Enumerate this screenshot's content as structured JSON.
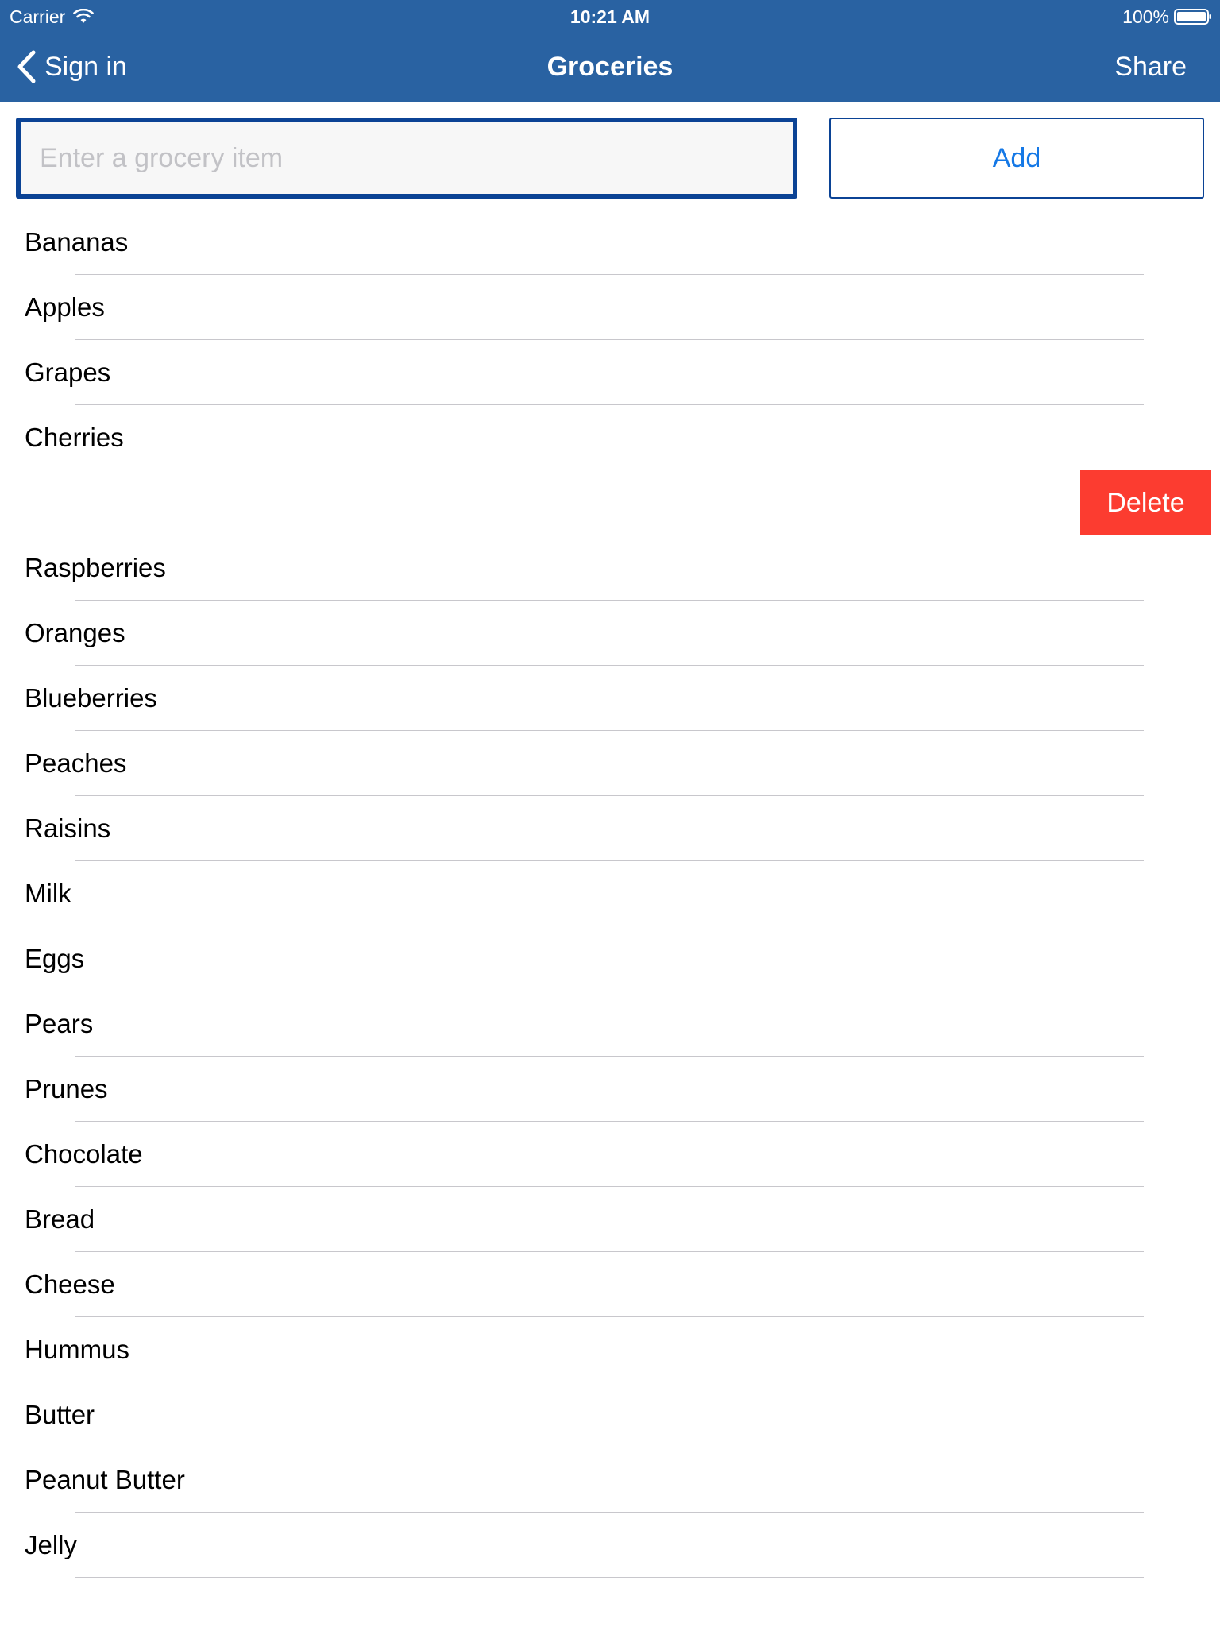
{
  "status_bar": {
    "carrier": "Carrier",
    "time": "10:21 AM",
    "battery": "100%"
  },
  "nav": {
    "back_label": "Sign in",
    "title": "Groceries",
    "share_label": "Share"
  },
  "entry": {
    "placeholder": "Enter a grocery item",
    "add_label": "Add"
  },
  "items": [
    {
      "label": "Bananas"
    },
    {
      "label": "Apples"
    },
    {
      "label": "Grapes"
    },
    {
      "label": "Cherries"
    },
    {
      "label": "",
      "swiped": true,
      "delete_label": "Delete"
    },
    {
      "label": "Raspberries"
    },
    {
      "label": "Oranges"
    },
    {
      "label": "Blueberries"
    },
    {
      "label": "Peaches"
    },
    {
      "label": "Raisins"
    },
    {
      "label": "Milk"
    },
    {
      "label": "Eggs"
    },
    {
      "label": "Pears"
    },
    {
      "label": "Prunes"
    },
    {
      "label": "Chocolate"
    },
    {
      "label": "Bread"
    },
    {
      "label": "Cheese"
    },
    {
      "label": "Hummus"
    },
    {
      "label": "Butter"
    },
    {
      "label": "Peanut Butter"
    },
    {
      "label": "Jelly"
    }
  ],
  "colors": {
    "nav_background": "#2962a2",
    "input_border": "#0b4395",
    "add_text": "#1478e6",
    "delete_background": "#fc3c30",
    "divider": "#c8c7cc"
  }
}
